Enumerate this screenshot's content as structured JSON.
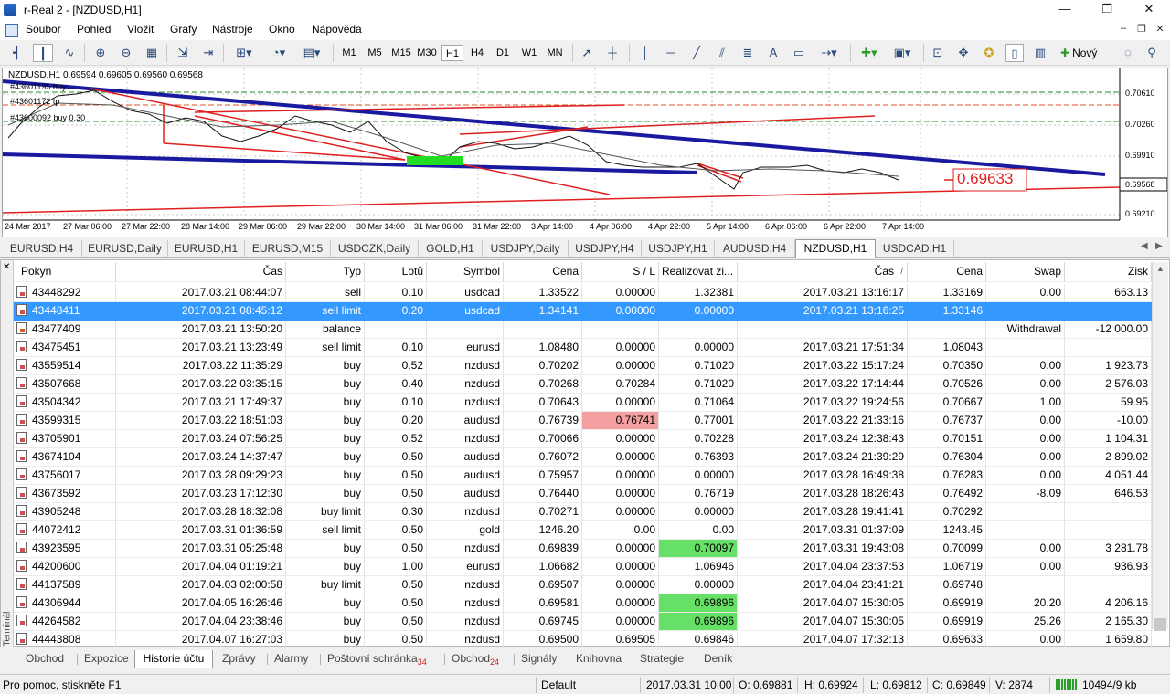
{
  "window": {
    "title": "r-Real 2 - [NZDUSD,H1]",
    "minimize": "—",
    "restore": "❐",
    "close": "✕"
  },
  "menu": [
    "Soubor",
    "Pohled",
    "Vložit",
    "Grafy",
    "Nástroje",
    "Okno",
    "Nápověda"
  ],
  "toolbar": {
    "timeframes": [
      "M1",
      "M5",
      "M15",
      "M30",
      "H1",
      "H4",
      "D1",
      "W1",
      "MN"
    ],
    "active_timeframe": "H1",
    "new_label": "Nový",
    "text_tool": "A"
  },
  "chart": {
    "header": "NZDUSD,H1  0.69594 0.69605 0.69560 0.69568",
    "order_labels": [
      "#43601195 buy",
      "#43601172 tp",
      "#43600092 buy 0.30"
    ],
    "price_ticks": [
      "0.70610",
      "0.70260",
      "0.69910",
      "0.69568",
      "0.69210"
    ],
    "current_price_marker": "0.69568",
    "big_price_label": "0.69633",
    "time_ticks": [
      "24 Mar 2017",
      "27 Mar 06:00",
      "27 Mar 22:00",
      "28 Mar 14:00",
      "29 Mar 06:00",
      "29 Mar 22:00",
      "30 Mar 14:00",
      "31 Mar 06:00",
      "31 Mar 22:00",
      "3 Apr 14:00",
      "4 Apr 06:00",
      "4 Apr 22:00",
      "5 Apr 14:00",
      "6 Apr 06:00",
      "6 Apr 22:00",
      "7 Apr 14:00"
    ],
    "colors": {
      "trend_blue": "#1a1aa0",
      "trend_red": "#e02020",
      "green_box": "#22dd22"
    }
  },
  "chart_tabs": [
    "EURUSD,H4",
    "EURUSD,Daily",
    "EURUSD,H1",
    "EURUSD,M15",
    "USDCZK,Daily",
    "GOLD,H1",
    "USDJPY,Daily",
    "USDJPY,H4",
    "USDJPY,H1",
    "AUDUSD,H4",
    "NZDUSD,H1",
    "USDCAD,H1"
  ],
  "active_chart_tab": "NZDUSD,H1",
  "table": {
    "headers": [
      "Pokyn",
      "Čas",
      "Typ",
      "Lotů",
      "Symbol",
      "Cena",
      "S / L",
      "Realizovat zi...",
      "Čas",
      "Cena",
      "Swap",
      "Zisk"
    ],
    "sort_indicator": "/",
    "rows": [
      [
        "43448292",
        "2017.03.21 08:44:07",
        "sell",
        "0.10",
        "usdcad",
        "1.33522",
        "0.00000",
        "1.32381",
        "2017.03.21 13:16:17",
        "1.33169",
        "0.00",
        "663.13"
      ],
      [
        "43448411",
        "2017.03.21 08:45:12",
        "sell limit",
        "0.20",
        "usdcad",
        "1.34141",
        "0.00000",
        "0.00000",
        "2017.03.21 13:16:25",
        "1.33146",
        "",
        ""
      ],
      [
        "43477409",
        "2017.03.21 13:50:20",
        "balance",
        "",
        "",
        "",
        "",
        "",
        "",
        "",
        "Withdrawal",
        "-12 000.00"
      ],
      [
        "43475451",
        "2017.03.21 13:23:49",
        "sell limit",
        "0.10",
        "eurusd",
        "1.08480",
        "0.00000",
        "0.00000",
        "2017.03.21 17:51:34",
        "1.08043",
        "",
        ""
      ],
      [
        "43559514",
        "2017.03.22 11:35:29",
        "buy",
        "0.52",
        "nzdusd",
        "0.70202",
        "0.00000",
        "0.71020",
        "2017.03.22 15:17:24",
        "0.70350",
        "0.00",
        "1 923.73"
      ],
      [
        "43507668",
        "2017.03.22 03:35:15",
        "buy",
        "0.40",
        "nzdusd",
        "0.70268",
        "0.70284",
        "0.71020",
        "2017.03.22 17:14:44",
        "0.70526",
        "0.00",
        "2 576.03"
      ],
      [
        "43504342",
        "2017.03.21 17:49:37",
        "buy",
        "0.10",
        "nzdusd",
        "0.70643",
        "0.00000",
        "0.71064",
        "2017.03.22 19:24:56",
        "0.70667",
        "1.00",
        "59.95"
      ],
      [
        "43599315",
        "2017.03.22 18:51:03",
        "buy",
        "0.20",
        "audusd",
        "0.76739",
        "0.76741",
        "0.77001",
        "2017.03.22 21:33:16",
        "0.76737",
        "0.00",
        "-10.00"
      ],
      [
        "43705901",
        "2017.03.24 07:56:25",
        "buy",
        "0.52",
        "nzdusd",
        "0.70066",
        "0.00000",
        "0.70228",
        "2017.03.24 12:38:43",
        "0.70151",
        "0.00",
        "1 104.31"
      ],
      [
        "43674104",
        "2017.03.24 14:37:47",
        "buy",
        "0.50",
        "audusd",
        "0.76072",
        "0.00000",
        "0.76393",
        "2017.03.24 21:39:29",
        "0.76304",
        "0.00",
        "2 899.02"
      ],
      [
        "43756017",
        "2017.03.28 09:29:23",
        "buy",
        "0.50",
        "audusd",
        "0.75957",
        "0.00000",
        "0.00000",
        "2017.03.28 16:49:38",
        "0.76283",
        "0.00",
        "4 051.44"
      ],
      [
        "43673592",
        "2017.03.23 17:12:30",
        "buy",
        "0.50",
        "audusd",
        "0.76440",
        "0.00000",
        "0.76719",
        "2017.03.28 18:26:43",
        "0.76492",
        "-8.09",
        "646.53"
      ],
      [
        "43905248",
        "2017.03.28 18:32:08",
        "buy limit",
        "0.30",
        "nzdusd",
        "0.70271",
        "0.00000",
        "0.00000",
        "2017.03.28 19:41:41",
        "0.70292",
        "",
        ""
      ],
      [
        "44072412",
        "2017.03.31 01:36:59",
        "sell limit",
        "0.50",
        "gold",
        "1246.20",
        "0.00",
        "0.00",
        "2017.03.31 01:37:09",
        "1243.45",
        "",
        ""
      ],
      [
        "43923595",
        "2017.03.31 05:25:48",
        "buy",
        "0.50",
        "nzdusd",
        "0.69839",
        "0.00000",
        "0.70097",
        "2017.03.31 19:43:08",
        "0.70099",
        "0.00",
        "3 281.78"
      ],
      [
        "44200600",
        "2017.04.04 01:19:21",
        "buy",
        "1.00",
        "eurusd",
        "1.06682",
        "0.00000",
        "1.06946",
        "2017.04.04 23:37:53",
        "1.06719",
        "0.00",
        "936.93"
      ],
      [
        "44137589",
        "2017.04.03 02:00:58",
        "buy limit",
        "0.50",
        "nzdusd",
        "0.69507",
        "0.00000",
        "0.00000",
        "2017.04.04 23:41:21",
        "0.69748",
        "",
        ""
      ],
      [
        "44306944",
        "2017.04.05 16:26:46",
        "buy",
        "0.50",
        "nzdusd",
        "0.69581",
        "0.00000",
        "0.69896",
        "2017.04.07 15:30:05",
        "0.69919",
        "20.20",
        "4 206.16"
      ],
      [
        "44264582",
        "2017.04.04 23:38:46",
        "buy",
        "0.50",
        "nzdusd",
        "0.69745",
        "0.00000",
        "0.69896",
        "2017.04.07 15:30:05",
        "0.69919",
        "25.26",
        "2 165.30"
      ],
      [
        "44443808",
        "2017.04.07 16:27:03",
        "buy",
        "0.50",
        "nzdusd",
        "0.69500",
        "0.69505",
        "0.69846",
        "2017.04.07 17:32:13",
        "0.69633",
        "0.00",
        "1 659.80"
      ]
    ],
    "selected_row": "43448411"
  },
  "terminal_label": "Terminál",
  "terminal_tabs": [
    {
      "label": "Obchod",
      "badge": ""
    },
    {
      "label": "Expozice",
      "badge": ""
    },
    {
      "label": "Historie účtu",
      "badge": ""
    },
    {
      "label": "Zprávy",
      "badge": ""
    },
    {
      "label": "Alarmy",
      "badge": ""
    },
    {
      "label": "Poštovní schránka",
      "badge": "34"
    },
    {
      "label": "Obchod",
      "badge": "24"
    },
    {
      "label": "Signály",
      "badge": ""
    },
    {
      "label": "Knihovna",
      "badge": ""
    },
    {
      "label": "Strategie",
      "badge": ""
    },
    {
      "label": "Deník",
      "badge": ""
    }
  ],
  "active_terminal_tab": "Historie účtu",
  "status": {
    "help": "Pro pomoc, stiskněte F1",
    "profile": "Default",
    "datetime": "2017.03.31 10:00",
    "open": "O: 0.69881",
    "high": "H: 0.69924",
    "low": "L: 0.69812",
    "close": "C: 0.69849",
    "volume": "V: 2874",
    "traffic": "10494/9 kb"
  }
}
